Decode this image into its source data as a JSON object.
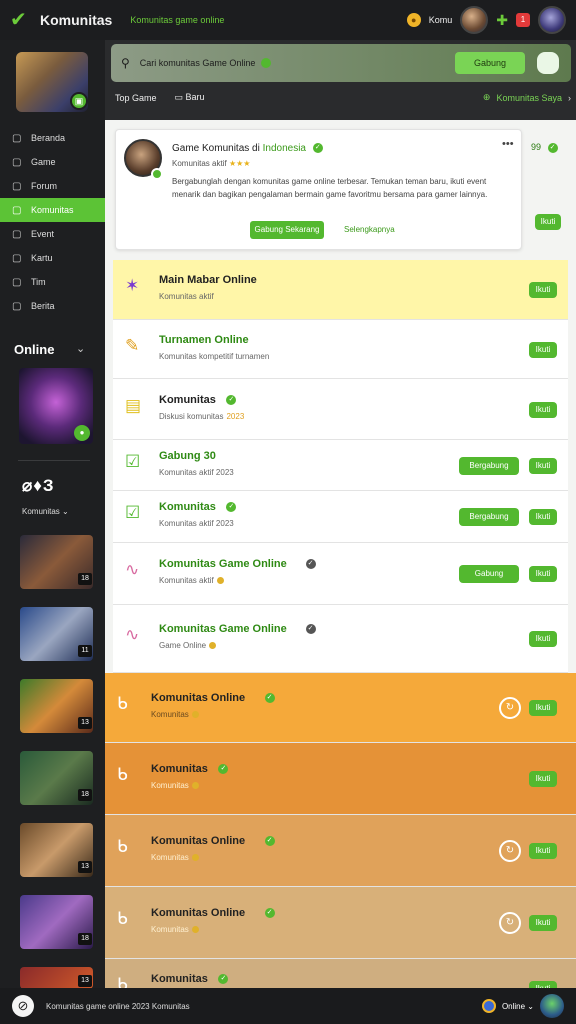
{
  "topbar": {
    "brand": "Komunitas",
    "subtitle": "Komunitas game online",
    "coin_label": "Komu",
    "badge_count": "1"
  },
  "sidebar": {
    "nav": [
      {
        "label": "Beranda",
        "icon": "home-icon"
      },
      {
        "label": "Game",
        "icon": "gamepad-icon"
      },
      {
        "label": "Forum",
        "icon": "chat-icon"
      },
      {
        "label": "Komunitas",
        "icon": "people-icon",
        "active": true
      },
      {
        "label": "Event",
        "icon": "calendar-icon"
      },
      {
        "label": "Kartu",
        "icon": "card-icon"
      },
      {
        "label": "Tim",
        "icon": "team-icon"
      },
      {
        "label": "Berita",
        "icon": "news-icon"
      }
    ],
    "online_label": "Online",
    "logos_text": "⌀♦З",
    "dropdown_label": "Komunitas",
    "thumb_badges": [
      "18",
      "11",
      "13",
      "18",
      "13",
      "18",
      "13"
    ]
  },
  "search": {
    "placeholder": "Cari komunitas Game Online",
    "button": "Gabung"
  },
  "subtabs": {
    "left_a": "Top Game",
    "left_b": "Baru",
    "right": "Komunitas Saya"
  },
  "feature": {
    "title_prefix": "Game Komunitas di ",
    "title_highlight": "Indonesia",
    "rating_text": "Komunitas aktif",
    "stars": "★★★",
    "description": "Bergabunglah dengan komunitas game online terbesar. Temukan teman baru, ikuti event menarik dan bagikan pengalaman bermain game favoritmu bersama para gamer lainnya.",
    "button": "Gabung Sekarang",
    "link": "Selengkapnya",
    "side_num": "99",
    "side_pill": "Ikuti"
  },
  "rows": [
    {
      "title": "Main Mabar Online",
      "meta": "Komunitas aktif",
      "pill": "Ikuti",
      "icon": "✶"
    },
    {
      "title": "Turnamen Online",
      "meta": "Komunitas kompetitif turnamen",
      "pill": "Ikuti",
      "icon": "✎"
    },
    {
      "title": "Komunitas",
      "meta": "Diskusi komunitas",
      "meta_hl": "2023",
      "pill": "Ikuti",
      "icon": "▤"
    },
    {
      "title": "Gabung 30",
      "meta": "Komunitas aktif 2023",
      "action": "Bergabung",
      "pill": "Ikuti",
      "icon": "☑"
    },
    {
      "title": "Komunitas",
      "meta": "Komunitas aktif 2023",
      "action": "Bergabung",
      "pill": "Ikuti",
      "icon": "☑"
    },
    {
      "title": "Komunitas Game Online",
      "meta": "Komunitas aktif",
      "action": "Gabung",
      "pill": "Ikuti",
      "icon": "∿"
    },
    {
      "title": "Komunitas Game Online",
      "meta": "Game Online",
      "pill": "Ikuti",
      "icon": "∿"
    },
    {
      "title": "Komunitas Online",
      "meta": "Komunitas",
      "pill": "Ikuti",
      "icon": "ᑲ"
    },
    {
      "title": "Komunitas",
      "meta": "Komunitas",
      "pill": "Ikuti",
      "icon": "ᑲ"
    },
    {
      "title": "Komunitas Online",
      "meta": "Komunitas",
      "pill": "Ikuti",
      "icon": "ᑲ"
    },
    {
      "title": "Komunitas Online",
      "meta": "Komunitas",
      "pill": "Ikuti",
      "icon": "ᑲ"
    },
    {
      "title": "Komunitas",
      "meta": "",
      "pill": "Ikuti",
      "icon": "ᑲ"
    }
  ],
  "footer": {
    "text": "Komunitas game online 2023 Komunitas",
    "status": "Online"
  },
  "colors": {
    "accent": "#53b82f",
    "yellow_row": "#fff6a8",
    "orange_1": "#f5a93a",
    "orange_2": "#e59237",
    "orange_3": "#e0a25a",
    "orange_4": "#d8b079"
  }
}
